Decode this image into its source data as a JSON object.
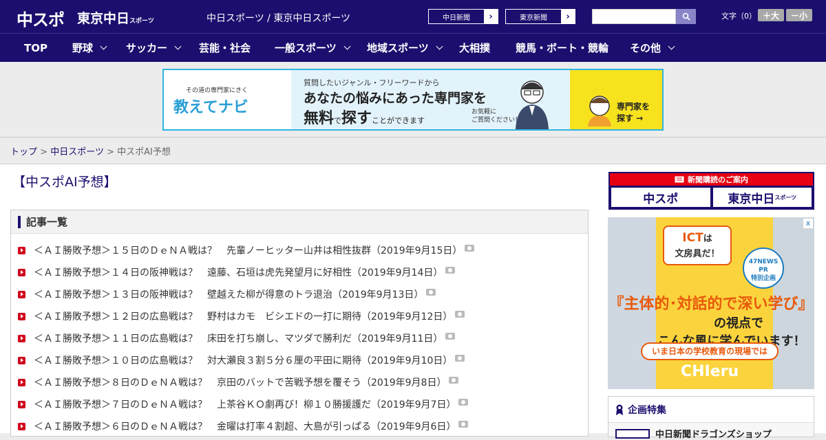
{
  "header": {
    "logo_chuspo": "中スポ",
    "logo_tokyo": "東京中日",
    "logo_tokyo_small": "スポーツ",
    "site_names": "中日スポーツ / 東京中日スポーツ",
    "btn_chunichi": "中日新聞",
    "btn_tokyo": "東京新聞",
    "search_placeholder": "",
    "font_label": "文字（0）",
    "font_larger": "＋大",
    "font_smaller": "－小",
    "arrow": "›"
  },
  "nav": {
    "items": [
      {
        "label": "TOP"
      },
      {
        "label": "野球"
      },
      {
        "label": "サッカー"
      },
      {
        "label": "芸能・社会"
      },
      {
        "label": "一般スポーツ"
      },
      {
        "label": "地域スポーツ"
      },
      {
        "label": "大相撲"
      },
      {
        "label": "競馬・ボート・競輪"
      },
      {
        "label": "その他"
      }
    ]
  },
  "banner": {
    "tagline": "その道の専門家にきく",
    "brand": "教えてナビ",
    "line1": "質問したいジャンル・フリーワードから",
    "line2": "あなたの悩みにあった専門家を",
    "line3_a": "無料",
    "line3_b": "で",
    "line3_c": "探す",
    "line3_d": "ことができます",
    "note1": "お気軽に",
    "note2": "ご質問ください！",
    "cta1": "専門家を",
    "cta2": "探す →"
  },
  "breadcrumb": {
    "top": "トップ",
    "section": "中日スポーツ",
    "current": "中スポAI予想",
    "sep": ">"
  },
  "page_title": "【中スポAI予想】",
  "article_list": {
    "heading": "記事一覧",
    "items": [
      "＜ＡＩ勝敗予想＞１５日のＤｅＮＡ戦は？　先輩ノーヒッター山井は相性抜群（2019年9月15日）",
      "＜ＡＩ勝敗予想＞１４日の阪神戦は？　遠藤、石垣は虎先発望月に好相性（2019年9月14日）",
      "＜ＡＩ勝敗予想＞１３日の阪神戦は？　壁越えた柳が得意のトラ退治（2019年9月13日）",
      "＜ＡＩ勝敗予想＞１２日の広島戦は？　野村はカモ　ビシエドの一打に期待（2019年9月12日）",
      "＜ＡＩ勝敗予想＞１１日の広島戦は？　床田を打ち崩し、マツダで勝利だ（2019年9月11日）",
      "＜ＡＩ勝敗予想＞１０日の広島戦は？　対大瀬良３割５分６厘の平田に期待（2019年9月10日）",
      "＜ＡＩ勝敗予想＞８日のＤｅＮＡ戦は？　京田のバットで苦戦予想を覆そう（2019年9月8日）",
      "＜ＡＩ勝敗予想＞７日のＤｅＮＡ戦は？　上茶谷ＫＯ劇再び！柳１０勝援護だ（2019年9月7日）",
      "＜ＡＩ勝敗予想＞６日のＤｅＮＡ戦は？　金曜は打率４割超、大島が引っぱる（2019年9月6日）"
    ]
  },
  "sidebar": {
    "subscribe_head": "新聞購読のご案内",
    "sub_chuspo": "中スポ",
    "sub_tokyo": "東京中日",
    "sub_tokyo_small": "スポーツ",
    "ad": {
      "ict_a": "ICT",
      "ict_b": "は",
      "ict_c": "文房具だ！",
      "pr1": "47NEWS",
      "pr2": "PR",
      "pr3": "特別企画",
      "headline1": "『主体的･対話的で深い学び』",
      "headline2": "の視点で",
      "headline3": "こんな風に学んでいます！",
      "ribbon": "いま日本の学校教育の現場では",
      "brand": "CHIeru",
      "close": "x"
    },
    "feature_heading": "企画特集",
    "feature_item": "中日新聞ドラゴンズショップ"
  },
  "colors": {
    "header_bg": "#1a0f6e",
    "accent_red": "#d0021b",
    "banner_border": "#2fb5e0"
  }
}
